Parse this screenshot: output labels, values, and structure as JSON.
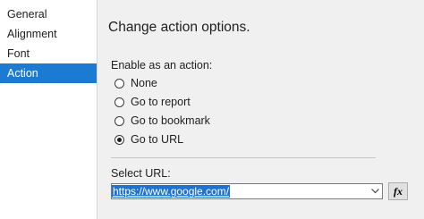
{
  "sidebar": {
    "items": [
      {
        "label": "General"
      },
      {
        "label": "Alignment"
      },
      {
        "label": "Font"
      },
      {
        "label": "Action",
        "selected": true
      }
    ]
  },
  "main": {
    "title": "Change action options.",
    "enable_label": "Enable as an action:",
    "options": [
      {
        "label": "None",
        "checked": false
      },
      {
        "label": "Go to report",
        "checked": false
      },
      {
        "label": "Go to bookmark",
        "checked": false
      },
      {
        "label": "Go to URL",
        "checked": true
      }
    ],
    "url_label": "Select URL:",
    "url_value": "https://www.google.com/",
    "fx_label": "fx"
  },
  "colors": {
    "selection": "#1b7bd3",
    "panel_background": "#f0f0f0"
  }
}
